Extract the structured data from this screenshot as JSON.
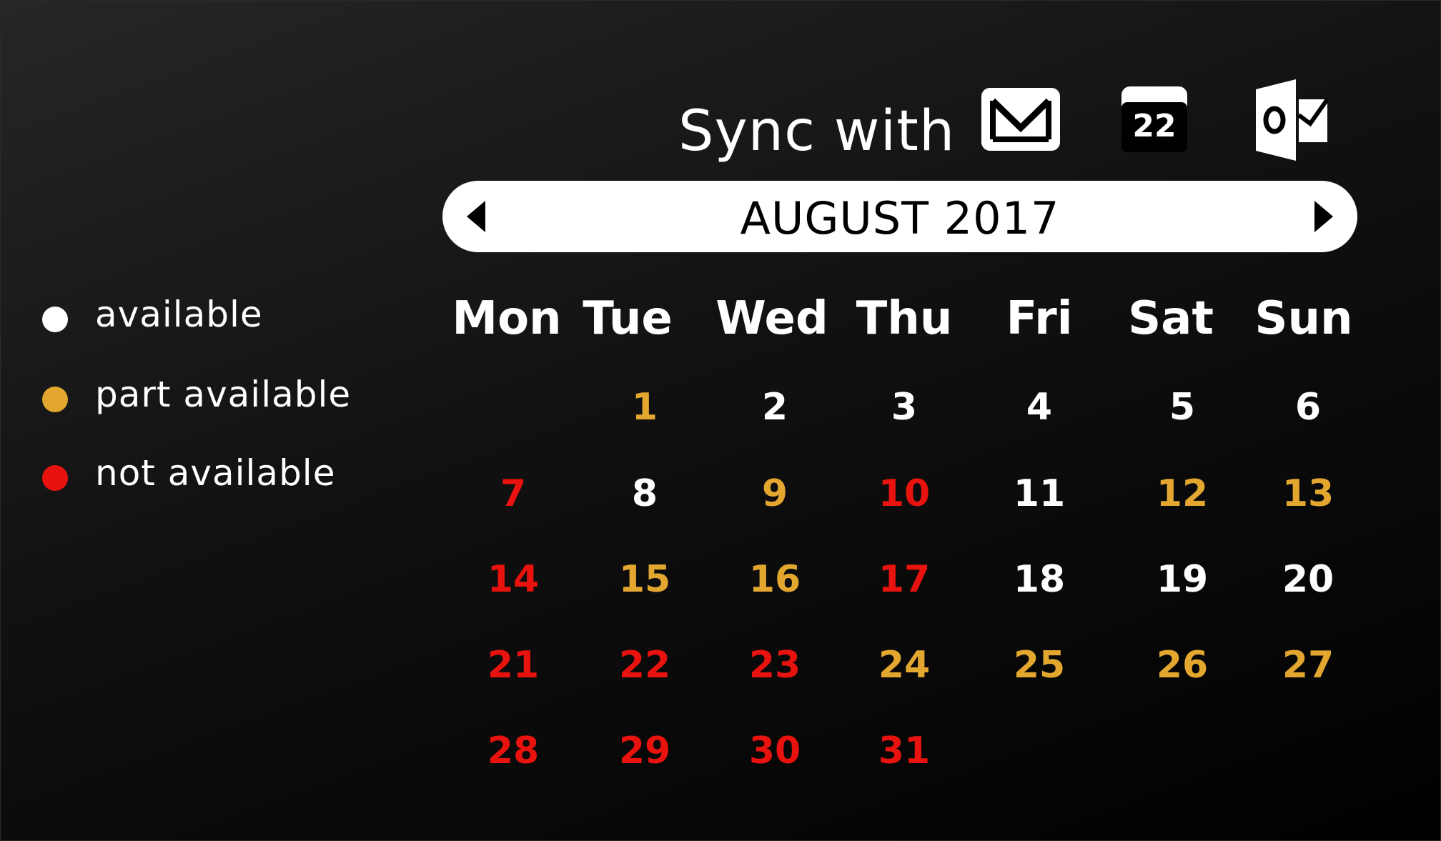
{
  "sync": {
    "label": "Sync with",
    "services": [
      {
        "icon": "mail-icon"
      },
      {
        "icon": "google-calendar-icon",
        "badge": "22"
      },
      {
        "icon": "outlook-icon"
      }
    ]
  },
  "calendar": {
    "month_title": "AUGUST 2017",
    "weekdays": [
      "Mon",
      "Tue",
      "Wed",
      "Thu",
      "Fri",
      "Sat",
      "Sun"
    ],
    "colors": {
      "available": "#ffffff",
      "part": "#e3a72f",
      "not": "#e8120e"
    },
    "weeks": [
      [
        null,
        {
          "d": "1",
          "s": "part"
        },
        {
          "d": "2",
          "s": "available"
        },
        {
          "d": "3",
          "s": "available"
        },
        {
          "d": "4",
          "s": "available"
        },
        {
          "d": "5",
          "s": "available"
        },
        {
          "d": "6",
          "s": "available"
        }
      ],
      [
        {
          "d": "7",
          "s": "not"
        },
        {
          "d": "8",
          "s": "available"
        },
        {
          "d": "9",
          "s": "part"
        },
        {
          "d": "10",
          "s": "not"
        },
        {
          "d": "11",
          "s": "available"
        },
        {
          "d": "12",
          "s": "part"
        },
        {
          "d": "13",
          "s": "part"
        }
      ],
      [
        {
          "d": "14",
          "s": "not"
        },
        {
          "d": "15",
          "s": "part"
        },
        {
          "d": "16",
          "s": "part"
        },
        {
          "d": "17",
          "s": "not"
        },
        {
          "d": "18",
          "s": "available"
        },
        {
          "d": "19",
          "s": "available"
        },
        {
          "d": "20",
          "s": "available"
        }
      ],
      [
        {
          "d": "21",
          "s": "not"
        },
        {
          "d": "22",
          "s": "not"
        },
        {
          "d": "23",
          "s": "not"
        },
        {
          "d": "24",
          "s": "part"
        },
        {
          "d": "25",
          "s": "part"
        },
        {
          "d": "26",
          "s": "part"
        },
        {
          "d": "27",
          "s": "part"
        }
      ],
      [
        {
          "d": "28",
          "s": "not"
        },
        {
          "d": "29",
          "s": "not"
        },
        {
          "d": "30",
          "s": "not"
        },
        {
          "d": "31",
          "s": "not"
        },
        null,
        null,
        null
      ]
    ]
  },
  "legend": [
    {
      "label": "available",
      "color": "#ffffff"
    },
    {
      "label": "part available",
      "color": "#e3a72f"
    },
    {
      "label": "not available",
      "color": "#e8120e"
    }
  ]
}
